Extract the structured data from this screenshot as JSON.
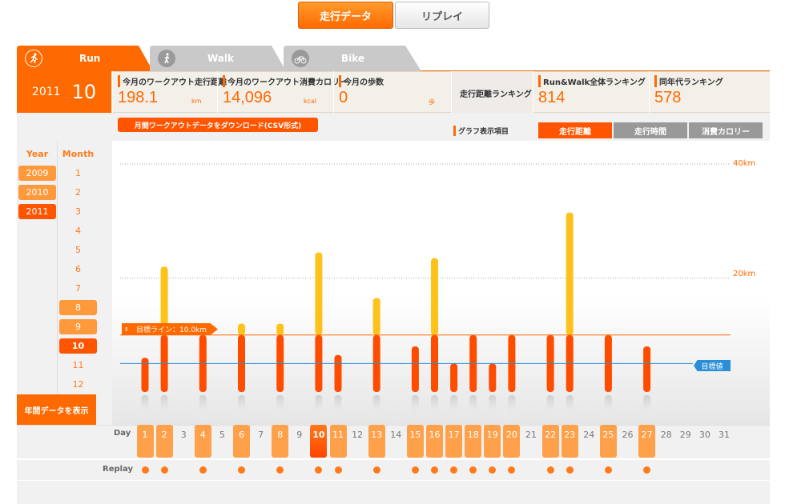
{
  "top_tabs": {
    "active": "走行データ",
    "inactive": "リプレイ"
  },
  "activity_tabs": [
    {
      "label": "Run",
      "active": true
    },
    {
      "label": "Walk",
      "active": false
    },
    {
      "label": "Bike",
      "active": false
    }
  ],
  "date": {
    "year": "2011",
    "month": "10"
  },
  "stats": [
    {
      "caption": "今月のワークアウト走行距離",
      "value": "198.1",
      "unit": "km"
    },
    {
      "caption": "今月のワークアウト消費カロリー",
      "value": "14,096",
      "unit": "kcal"
    },
    {
      "caption": "今月の歩数",
      "value": "0",
      "unit": "歩"
    },
    {
      "caption": "走行距離ランキング",
      "value": "",
      "unit": ""
    },
    {
      "caption": "Run&Walk全体ランキング",
      "value": "814",
      "unit": ""
    },
    {
      "caption": "同年代ランキング",
      "value": "578",
      "unit": ""
    }
  ],
  "download_button": "月間ワークアウトデータをダウンロード(CSV形式)",
  "graph_label": "グラフ表示項目",
  "graph_tabs": [
    {
      "label": "走行距離",
      "active": true
    },
    {
      "label": "走行時間",
      "active": false
    },
    {
      "label": "消費カロリー",
      "active": false
    }
  ],
  "selector": {
    "year_header": "Year",
    "month_header": "Month",
    "years": [
      "2009",
      "2010",
      "2011"
    ],
    "selected_year": "2011",
    "months": [
      "1",
      "2",
      "3",
      "4",
      "5",
      "6",
      "7",
      "8",
      "9",
      "10",
      "11",
      "12"
    ],
    "selected_month": "10",
    "year_data_button": "年間データを表示"
  },
  "axis_labels": [
    "40km",
    "20km"
  ],
  "target_line_label": "目標ライン：10.0km",
  "target_value_label": "目標値",
  "day_row_label": "Day",
  "replay_row_label": "Replay",
  "colors": {
    "accent": "#ff6a00",
    "bar_under": "#ff4d00",
    "bar_over": "#ffc21a",
    "blue_line": "#2a8fd6"
  },
  "chart_data": {
    "type": "bar",
    "ylim": [
      0,
      45
    ],
    "target": 10,
    "blue_value": 5,
    "days": [
      1,
      2,
      3,
      4,
      5,
      6,
      7,
      8,
      9,
      10,
      11,
      12,
      13,
      14,
      15,
      16,
      17,
      18,
      19,
      20,
      21,
      22,
      23,
      24,
      25,
      26,
      27,
      28,
      29,
      30,
      31
    ],
    "values": [
      {
        "day": 1,
        "km": 6
      },
      {
        "day": 2,
        "km": 22
      },
      {
        "day": 4,
        "km": 10
      },
      {
        "day": 6,
        "km": 12
      },
      {
        "day": 8,
        "km": 12
      },
      {
        "day": 10,
        "km": 24.5
      },
      {
        "day": 11,
        "km": 6.5
      },
      {
        "day": 13,
        "km": 16.5
      },
      {
        "day": 15,
        "km": 8
      },
      {
        "day": 16,
        "km": 23.5
      },
      {
        "day": 17,
        "km": 5
      },
      {
        "day": 18,
        "km": 10
      },
      {
        "day": 19,
        "km": 5
      },
      {
        "day": 20,
        "km": 10
      },
      {
        "day": 22,
        "km": 10
      },
      {
        "day": 23,
        "km": 31.5
      },
      {
        "day": 25,
        "km": 10
      },
      {
        "day": 27,
        "km": 8
      }
    ],
    "replay_days": [
      1,
      2,
      4,
      6,
      8,
      10,
      11,
      13,
      15,
      16,
      17,
      18,
      19,
      20,
      22,
      23,
      25,
      27
    ],
    "selected_day": 10
  }
}
